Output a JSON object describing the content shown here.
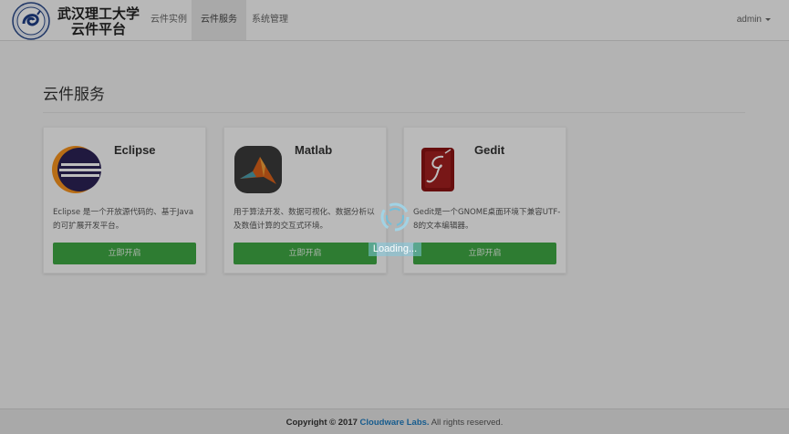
{
  "header": {
    "brand_line1": "武汉理工大学",
    "brand_line2": "云件平台",
    "nav": [
      {
        "label": "云件实例",
        "active": false
      },
      {
        "label": "云件服务",
        "active": true
      },
      {
        "label": "系统管理",
        "active": false
      }
    ],
    "user": "admin"
  },
  "page": {
    "title": "云件服务"
  },
  "services": [
    {
      "name": "Eclipse",
      "icon": "eclipse-icon",
      "desc": "Eclipse 是一个开放源代码的、基于Java的可扩展开发平台。",
      "button": "立即开启"
    },
    {
      "name": "Matlab",
      "icon": "matlab-icon",
      "desc": "用于算法开发、数据可视化、数据分析以及数值计算的交互式环境。",
      "button": "立即开启"
    },
    {
      "name": "Gedit",
      "icon": "gedit-icon",
      "desc": "Gedit是一个GNOME桌面环境下兼容UTF-8的文本编辑器。",
      "button": "立即开启"
    }
  ],
  "loading": {
    "text": "Loading..."
  },
  "footer": {
    "copyright": "Copyright © 2017",
    "company": "Cloudware Labs.",
    "rights": "All rights reserved."
  },
  "colors": {
    "button": "#3fa844",
    "link": "#1f7dc0",
    "overlay": "rgba(0,0,0,0.26)"
  }
}
